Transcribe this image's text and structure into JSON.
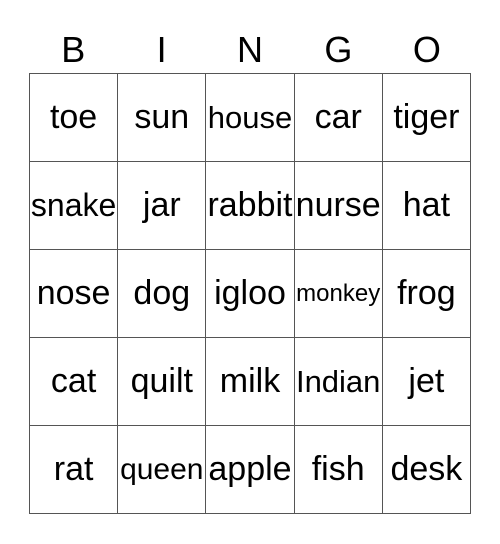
{
  "card": {
    "header": [
      "B",
      "I",
      "N",
      "G",
      "O"
    ],
    "rows": [
      [
        "toe",
        "sun",
        "house",
        "car",
        "tiger"
      ],
      [
        "snake",
        "jar",
        "rabbit",
        "nurse",
        "hat"
      ],
      [
        "nose",
        "dog",
        "igloo",
        "monkey",
        "frog"
      ],
      [
        "cat",
        "quilt",
        "milk",
        "Indian",
        "jet"
      ],
      [
        "rat",
        "queen",
        "apple",
        "fish",
        "desk"
      ]
    ]
  }
}
